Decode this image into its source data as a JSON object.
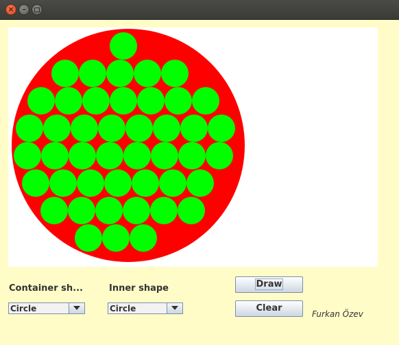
{
  "window": {
    "buttons": [
      "close",
      "minimize",
      "maximize"
    ]
  },
  "canvas": {
    "background": "#ffffff",
    "container": {
      "shape": "Circle",
      "color": "#ff0000"
    },
    "inner": {
      "shape": "Circle",
      "color": "#00ff00",
      "rows": [
        1,
        5,
        7,
        8,
        8,
        7,
        6,
        3
      ]
    }
  },
  "controls": {
    "container_label": "Container sh...",
    "container_value": "Circle",
    "inner_label": "Inner shape",
    "inner_value": "Circle",
    "draw_label": "Draw",
    "clear_label": "Clear"
  },
  "author": "Furkan Özev"
}
